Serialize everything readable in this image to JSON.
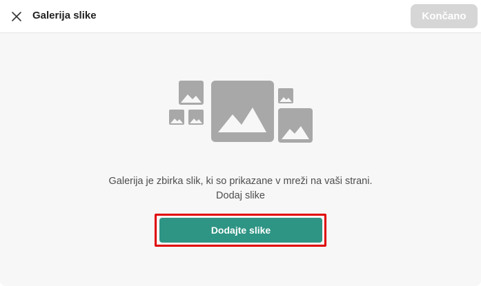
{
  "header": {
    "close_icon": "close-icon",
    "title": "Galerija slike",
    "done_label": "Končano"
  },
  "empty_state": {
    "illustration_icon": "image-gallery-icon",
    "description": "Galerija je zbirka slik, ki so prikazane v mreži na vaši strani. Dodaj slike",
    "add_button_label": "Dodajte slike"
  },
  "colors": {
    "primary": "#2e9484",
    "disabled": "#d6d6d6",
    "placeholder_gray": "#a8a8a8",
    "highlight": "#e00000"
  }
}
